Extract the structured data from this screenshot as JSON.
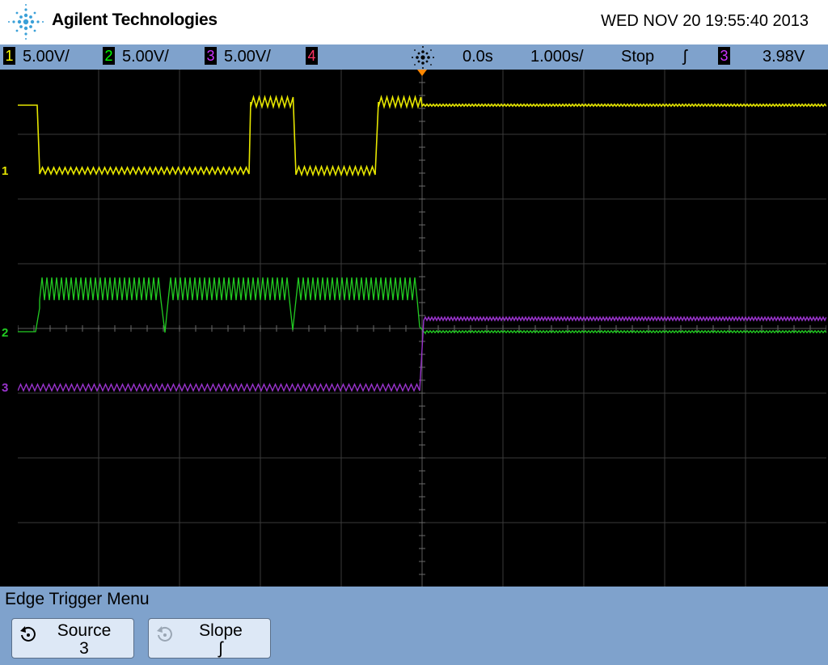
{
  "header": {
    "brand": "Agilent Technologies",
    "datetime": "WED NOV 20 19:55:40 2013",
    "logo_icon": "agilent-spark-logo-icon"
  },
  "status": {
    "channels": [
      {
        "num": "1",
        "scale": "5.00V/",
        "color": "#ffff00"
      },
      {
        "num": "2",
        "scale": "5.00V/",
        "color": "#00ff00"
      },
      {
        "num": "3",
        "scale": "5.00V/",
        "color": "#cc33ff"
      },
      {
        "num": "4",
        "scale": "",
        "color": "#ff3366"
      }
    ],
    "run_icon": "acquisition-spark-icon",
    "delay": "0.0s",
    "timebase": "1.000s/",
    "run_state": "Stop",
    "slope_symbol": "ʃ",
    "trigger_source": "3",
    "trigger_level": "3.98V"
  },
  "traces": {
    "ch1": {
      "color": "#e6e600",
      "label": "1"
    },
    "ch2": {
      "color": "#22cc22",
      "label": "2"
    },
    "ch3": {
      "color": "#9933cc",
      "label": "3"
    }
  },
  "menu": {
    "title": "Edge Trigger Menu",
    "softkeys": [
      {
        "label": "Source",
        "value": "3",
        "icon": "rotate-knob-icon"
      },
      {
        "label": "Slope",
        "value": "ʃ",
        "icon": "rotate-knob-icon"
      }
    ]
  }
}
